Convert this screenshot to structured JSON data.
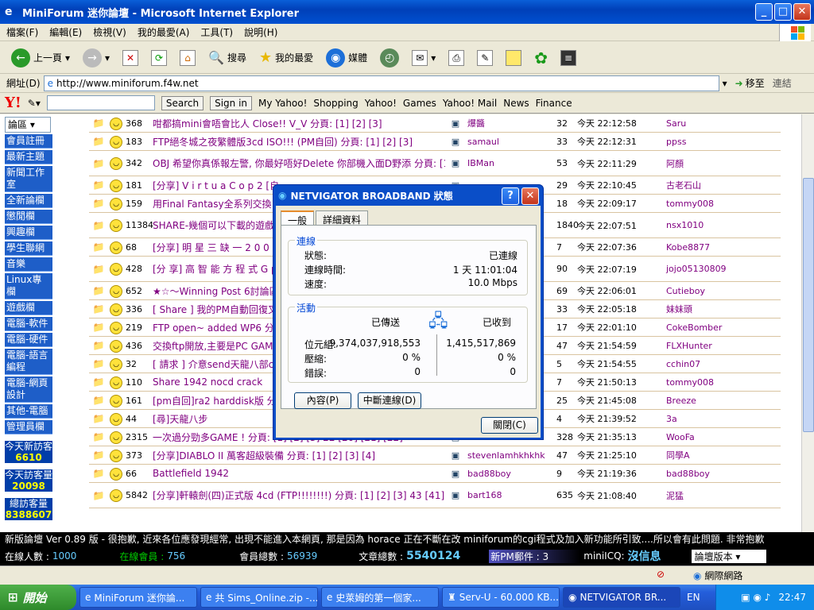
{
  "window": {
    "title": "MiniForum 迷你論壇 - Microsoft Internet Explorer"
  },
  "menu": [
    "檔案(F)",
    "編輯(E)",
    "檢視(V)",
    "我的最愛(A)",
    "工具(T)",
    "說明(H)"
  ],
  "toolbar": {
    "back": "上一頁",
    "search": "搜尋",
    "favorites": "我的最愛",
    "media": "媒體"
  },
  "address": {
    "label": "網址(D)",
    "url": "http://www.miniforum.f4w.net",
    "go": "移至",
    "links": "連結"
  },
  "yahoo": {
    "search": "Search",
    "signin": "Sign in",
    "my": "My Yahoo!",
    "shopping": "Shopping",
    "yahoo": "Yahoo!",
    "games": "Games",
    "mail": "Yahoo! Mail",
    "news": "News",
    "finance": "Finance"
  },
  "sidebar": {
    "select": "論區",
    "items": [
      "會員註冊",
      "最新主題",
      "新聞工作室",
      "全新論欄",
      "懲閒欄",
      "興趣欄",
      "學生聯網",
      "音樂",
      "Linux專欄",
      "遊戲欄",
      "電腦-軟件",
      "電腦-硬件",
      "電腦-語言編程",
      "電腦-網頁設計",
      "其他-電腦",
      "管理員欄"
    ],
    "counts": [
      {
        "label": "今天新訪客",
        "value": "6610"
      },
      {
        "label": "今天訪客量",
        "value": "20098"
      },
      {
        "label": "總訪客量",
        "value": "8388607"
      }
    ]
  },
  "rows": [
    {
      "id": "368",
      "title": "咁都搞mini會唔會比人 Close!! V_V 分頁: [1] [2] [3]",
      "author": "爆醬",
      "replies": "32",
      "time": "今天 22:12:58",
      "last": "Saru"
    },
    {
      "id": "183",
      "title": "FTP絕冬城之夜繁體版3cd ISO!!! (PM自回) 分頁: [1] [2] [3]",
      "author": "samaul",
      "replies": "33",
      "time": "今天 22:12:31",
      "last": "ppss"
    },
    {
      "id": "342",
      "title": "OBJ 希望你真係報左警, 你最好唔好Delete 你部機入面D野添 分頁: [1] [2] [3] [4]",
      "author": "IBMan",
      "replies": "53",
      "time": "今天 22:11:29",
      "last": "阿顏"
    },
    {
      "id": "181",
      "title": "[分享] V i r t u a C o p 2 [自",
      "author": "",
      "replies": "29",
      "time": "今天 22:10:45",
      "last": "古老石山"
    },
    {
      "id": "159",
      "title": "用Final Fantasy全系列交換1941",
      "author": "",
      "replies": "18",
      "time": "今天 22:09:17",
      "last": "tommy008"
    },
    {
      "id": "11384",
      "title": "SHARE-幾個可以下載的遊戲( [122] [123]",
      "author": "",
      "replies": "1840",
      "time": "今天 22:07:51",
      "last": "nsx1010"
    },
    {
      "id": "68",
      "title": "[分享] 明 星 三 缺 一 2 0 0 2",
      "author": "",
      "replies": "7",
      "time": "今天 22:07:36",
      "last": "Kobe8877"
    },
    {
      "id": "428",
      "title": "[分 享] 高 智 能 方 程 式 G p [5] [6] [7]",
      "author": "",
      "replies": "90",
      "time": "今天 22:07:19",
      "last": "jojo05130809"
    },
    {
      "id": "652",
      "title": "★☆～Winning Post 6討論區～",
      "author": "",
      "replies": "69",
      "time": "今天 22:06:01",
      "last": "Cutieboy"
    },
    {
      "id": "336",
      "title": "[ Share ] 我的PM自動回復叉蹟",
      "author": "",
      "replies": "33",
      "time": "今天 22:05:18",
      "last": "妹妹頭"
    },
    {
      "id": "219",
      "title": "FTP open~ added WP6 分頁:",
      "author": "",
      "replies": "17",
      "time": "今天 22:01:10",
      "last": "CokeBomber"
    },
    {
      "id": "436",
      "title": "交換ftp開放,主要是PC GAME",
      "author": "",
      "replies": "47",
      "time": "今天 21:54:59",
      "last": "FLXHunter"
    },
    {
      "id": "32",
      "title": "[ 請求 ] 介意send天龍八部cd1",
      "author": "",
      "replies": "5",
      "time": "今天 21:54:55",
      "last": "cchin07"
    },
    {
      "id": "110",
      "title": "Share 1942 nocd crack",
      "author": "",
      "replies": "7",
      "time": "今天 21:50:13",
      "last": "tommy008"
    },
    {
      "id": "161",
      "title": "[pm自回]ra2 harddisk版 分頁:",
      "author": "",
      "replies": "25",
      "time": "今天 21:45:08",
      "last": "Breeze"
    },
    {
      "id": "44",
      "title": "[尋]天龍八步",
      "author": "",
      "replies": "4",
      "time": "今天 21:39:52",
      "last": "3a"
    },
    {
      "id": "2315",
      "title": "一次過分勁多GAME ! 分頁: [1] [2] [3] 22 [20] [21] [22]",
      "author": "soft world",
      "replies": "328",
      "time": "今天 21:35:13",
      "last": "WooFa"
    },
    {
      "id": "373",
      "title": "[分享]DIABLO II 萬客超級裝備 分頁: [1] [2] [3] [4]",
      "author": "stevenlamhkhkhk",
      "replies": "47",
      "time": "今天 21:25:10",
      "last": "同學A"
    },
    {
      "id": "66",
      "title": "Battlefield 1942",
      "author": "bad88boy",
      "replies": "9",
      "time": "今天 21:19:36",
      "last": "bad88boy"
    },
    {
      "id": "5842",
      "title": "[分享]軒轅劍(四)正式版 4cd (FTP!!!!!!!!) 分頁: [1] [2] [3] 43 [41] [42] [43]",
      "author": "bart168",
      "replies": "635",
      "time": "今天 21:08:40",
      "last": "泥猛"
    }
  ],
  "ticker": "新版論壇 Ver 0.89 版 - 很抱歉, 近來各位應發現經常, 出現不能進入本網頁, 那是因為 horace 正在不斷在改 miniforum的cgi程式及加入新功能所引致....所以會有此問題. 非常抱歉",
  "stats": {
    "online_label": "在線人數 :",
    "online": "1000",
    "members_label": "在線會員 :",
    "members": "756",
    "total_label": "會員總數 :",
    "total": "56939",
    "posts_label": "文章總數 :",
    "posts": "5540124",
    "pm": "新PM郵件 : 3",
    "icq": "miniICQ:",
    "icq_status": "沒信息",
    "version": "論壇版本"
  },
  "iestatus": "網際網路",
  "taskbar": {
    "start": "開始",
    "tasks": [
      "MiniForum 迷你論...",
      "共 Sims_Online.zip -...",
      "史萊姆的第一個家...",
      "Serv-U - 60.000 KB...",
      "NETVIGATOR BR..."
    ],
    "lang": "EN",
    "clock": "22:47"
  },
  "dialog": {
    "title": "NETVIGATOR BROADBAND 狀態",
    "tabs": [
      "一般",
      "詳細資料"
    ],
    "conn_label": "連線",
    "status_label": "狀態:",
    "status": "已連線",
    "duration_label": "連線時間:",
    "duration": "1 天 11:01:04",
    "speed_label": "速度:",
    "speed": "10.0 Mbps",
    "act_label": "活動",
    "sent": "已傳送",
    "recv": "已收到",
    "bytes_label": "位元組:",
    "bytes_sent": "9,374,037,918,553",
    "bytes_recv": "1,415,517,869",
    "comp_label": "壓縮:",
    "comp_sent": "0 %",
    "comp_recv": "0 %",
    "err_label": "錯誤:",
    "err_sent": "0",
    "err_recv": "0",
    "props": "內容(P)",
    "disconnect": "中斷連線(D)",
    "close": "關閉(C)"
  }
}
